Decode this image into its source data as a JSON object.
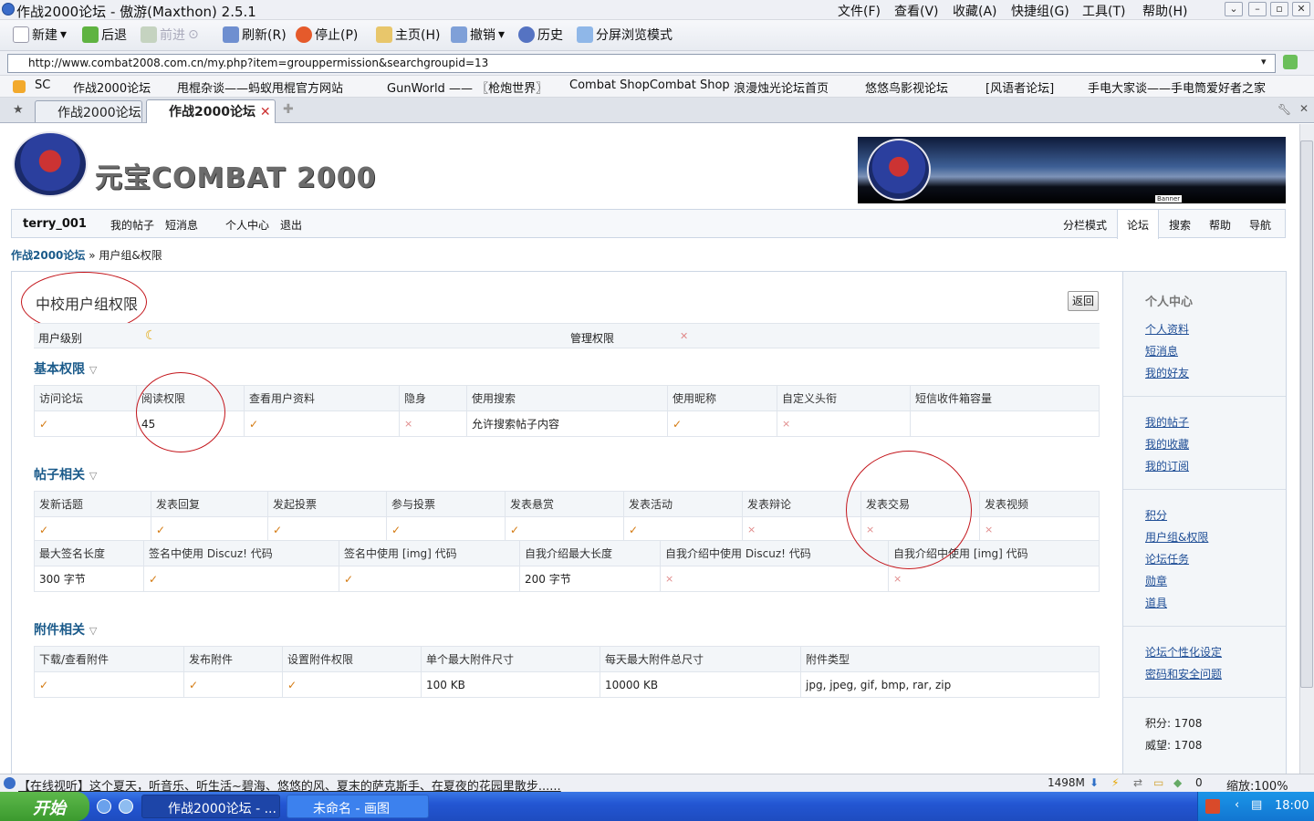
{
  "window": {
    "title": "作战2000论坛 - 傲游(Maxthon) 2.5.1",
    "menus": [
      "文件(F)",
      "查看(V)",
      "收藏(A)",
      "快捷组(G)",
      "工具(T)",
      "帮助(H)"
    ]
  },
  "toolbar": {
    "new": "新建",
    "back": "后退",
    "forward": "前进",
    "refresh": "刷新(R)",
    "stop": "停止(P)",
    "home": "主页(H)",
    "undo": "撤销",
    "history": "历史",
    "split": "分屏浏览模式"
  },
  "address": {
    "url": "http://www.combat2008.com.cn/my.php?item=grouppermission&searchgroupid=13"
  },
  "bookmarks": [
    "SC",
    "作战2000论坛",
    "甩棍杂谈——蚂蚁甩棍官方网站",
    "GunWorld —— 〖枪炮世界〗",
    "Combat ShopCombat Shop",
    "浪漫烛光论坛首页",
    "悠悠鸟影视论坛",
    "[风语者论坛]",
    "手电大家谈——手电筒爱好者之家"
  ],
  "tabs": [
    {
      "label": "作战2000论坛"
    },
    {
      "label": "作战2000论坛"
    }
  ],
  "site": {
    "logo_text": "元宝COMBAT 2000",
    "banner_label": "Banner"
  },
  "nav": {
    "user": "terry_001",
    "left": [
      "我的帖子",
      "短消息",
      "个人中心",
      "退出"
    ],
    "right": [
      "分栏模式",
      "论坛",
      "搜索",
      "帮助",
      "导航"
    ]
  },
  "breadcrumb": {
    "home": "作战2000论坛",
    "current": "» 用户组&权限"
  },
  "group": {
    "title": "中校用户组权限",
    "return": "返回",
    "level_label": "用户级别",
    "admin_label": "管理权限"
  },
  "basic": {
    "title": "基本权限",
    "headers": [
      "访问论坛",
      "阅读权限",
      "查看用户资料",
      "隐身",
      "使用搜索",
      "使用昵称",
      "自定义头衔",
      "短信收件箱容量"
    ],
    "values": [
      "✓",
      "45",
      "✓",
      "×",
      "允许搜索帖子内容",
      "✓",
      "×",
      ""
    ]
  },
  "posts": {
    "title": "帖子相关",
    "headers1": [
      "发新话题",
      "发表回复",
      "发起投票",
      "参与投票",
      "发表悬赏",
      "发表活动",
      "发表辩论",
      "发表交易",
      "发表视频"
    ],
    "values1": [
      "✓",
      "✓",
      "✓",
      "✓",
      "✓",
      "✓",
      "×",
      "×",
      "×"
    ],
    "headers2": [
      "最大签名长度",
      "签名中使用 Discuz! 代码",
      "签名中使用 [img] 代码",
      "自我介绍最大长度",
      "自我介绍中使用 Discuz! 代码",
      "自我介绍中使用 [img] 代码"
    ],
    "values2": [
      "300 字节",
      "✓",
      "✓",
      "200 字节",
      "×",
      "×"
    ]
  },
  "attach": {
    "title": "附件相关",
    "headers": [
      "下载/查看附件",
      "发布附件",
      "设置附件权限",
      "单个最大附件尺寸",
      "每天最大附件总尺寸",
      "附件类型"
    ],
    "values": [
      "✓",
      "✓",
      "✓",
      "100 KB",
      "10000 KB",
      "jpg, jpeg, gif, bmp, rar, zip"
    ]
  },
  "sidebar": {
    "title": "个人中心",
    "group1": [
      "个人资料",
      "短消息",
      "我的好友"
    ],
    "group2": [
      "我的帖子",
      "我的收藏",
      "我的订阅"
    ],
    "group3": [
      "积分",
      "用户组&权限",
      "论坛任务",
      "勋章",
      "道具"
    ],
    "group4": [
      "论坛个性化设定",
      "密码和安全问题"
    ],
    "stats": [
      "积分: 1708",
      "威望: 1708"
    ]
  },
  "status": {
    "message": "【在线视听】这个夏天，听音乐、听生活~碧海、悠悠的风、夏末的萨克斯手、在夏夜的花园里散步......",
    "memory": "1498M",
    "count": "0",
    "zoom": "缩放:100%"
  },
  "taskbar": {
    "start": "开始",
    "tasks": [
      "作战2000论坛 - ...",
      "未命名 - 画图"
    ],
    "clock": "18:00"
  }
}
